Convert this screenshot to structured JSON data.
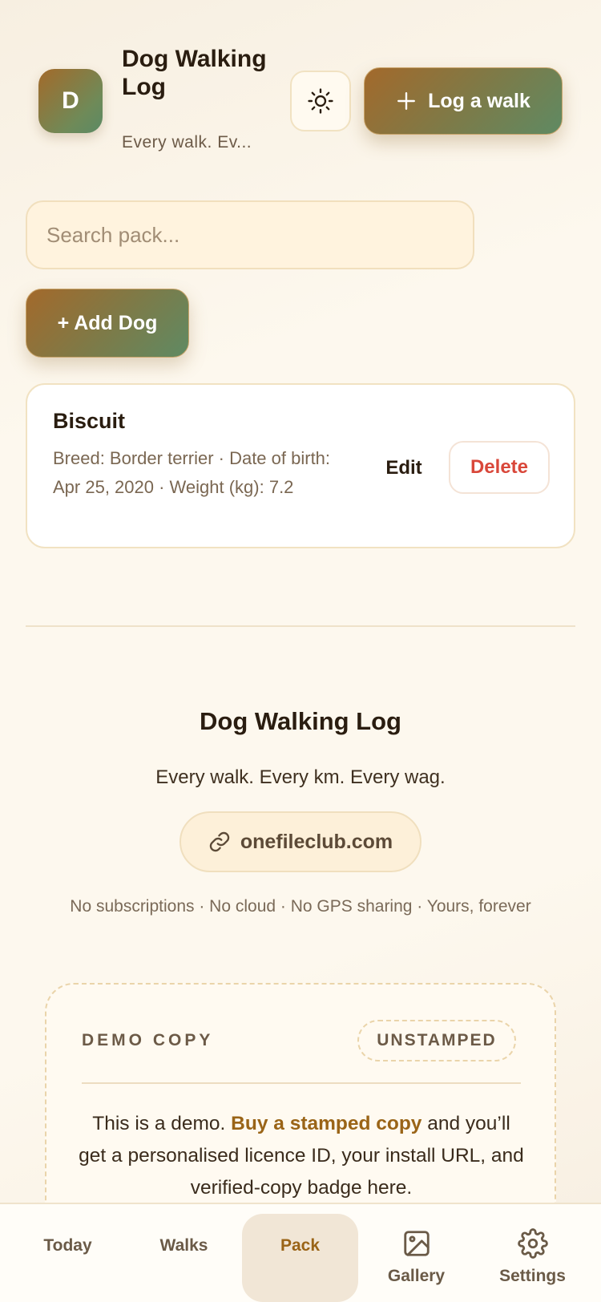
{
  "header": {
    "avatar_letter": "D",
    "app_title": "Dog Walking Log",
    "subtitle": "Every walk. Ev...",
    "log_walk_label": "Log a walk",
    "theme_icon": "sun-icon"
  },
  "search": {
    "placeholder": "Search pack..."
  },
  "add_dog_label": "+ Add Dog",
  "dogs": [
    {
      "name": "Biscuit",
      "meta": "Breed: Border terrier · Date of birth: Apr 25, 2020 · Weight (kg): 7.2",
      "edit_label": "Edit",
      "delete_label": "Delete"
    }
  ],
  "footer": {
    "title": "Dog Walking Log",
    "tagline": "Every walk. Every km. Every wag.",
    "site": "onefileclub.com",
    "note": "No subscriptions · No cloud · No GPS sharing · Yours, forever"
  },
  "demo": {
    "label": "DEMO COPY",
    "badge": "UNSTAMPED",
    "text_before": "This is a demo. ",
    "link": "Buy a stamped copy",
    "text_after": " and you’ll get a personalised licence ID, your install URL, and verified-copy badge here."
  },
  "nav": {
    "today": "Today",
    "walks": "Walks",
    "pack": "Pack",
    "gallery": "Gallery",
    "settings": "Settings"
  },
  "colors": {
    "accent_start": "#a3692b",
    "accent_end": "#5f8a63",
    "delete_red": "#d9473a",
    "link_brown": "#9a6417"
  }
}
